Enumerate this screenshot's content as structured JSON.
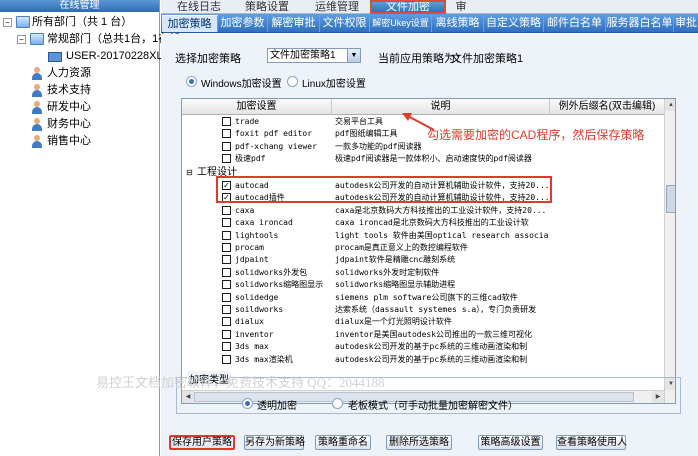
{
  "left_panel": {
    "header": "在线管理",
    "tree": [
      {
        "label": "所有部门（共 1 台）"
      },
      {
        "label": "常规部门（总共1台，1在线)"
      },
      {
        "label": "USER-20170228XL"
      },
      {
        "label": "人力资源"
      },
      {
        "label": "技术支持"
      },
      {
        "label": "研发中心"
      },
      {
        "label": "财务中心"
      },
      {
        "label": "销售中心"
      }
    ]
  },
  "top_tabs": [
    "在线日志",
    "策略设置",
    "运维管理",
    "文件加密",
    "审"
  ],
  "sub_tabs": [
    "加密策略",
    "加密参数",
    "解密审批",
    "文件权限",
    "解密Ukey设置",
    "离线策略",
    "自定义策略",
    "邮件白名单",
    "服务器白名单",
    "审批"
  ],
  "policy": {
    "select_label": "选择加密策略",
    "selected": "文件加密策略1",
    "current_label": "当前应用策略为：",
    "current_value": "文件加密策略1"
  },
  "platform": {
    "windows": "Windows加密设置",
    "linux": "Linux加密设置"
  },
  "grid": {
    "headers": [
      "加密设置",
      "说明",
      "例外后缀名(双击编辑)"
    ],
    "rows_top": [
      {
        "name": "trade",
        "desc": "交易平台工具",
        "checked": false
      },
      {
        "name": "foxit pdf editor",
        "desc": "pdf图纸编辑工具",
        "checked": false
      },
      {
        "name": "pdf-xchang viewer",
        "desc": "一款多功能的pdf阅读器",
        "checked": false
      },
      {
        "name": "极速pdf",
        "desc": "极速pdf阅读器是一款体积小、启动速度快的pdf阅读器",
        "checked": false
      }
    ],
    "group_label": "工程设计",
    "rows_group": [
      {
        "name": "autocad",
        "desc": "autodesk公司开发的自动计算机辅助设计软件，支持20...",
        "checked": true
      },
      {
        "name": "autocad插件",
        "desc": "autodesk公司开发的自动计算机辅助设计软件，支持20...",
        "checked": true
      },
      {
        "name": "caxa",
        "desc": "caxa是北京数码大方科技推出的工业设计软件，支持20...",
        "checked": false
      },
      {
        "name": "caxa ironcad",
        "desc": "caxa ironcad是北京数码大方科技推出的工业设计软",
        "checked": false
      },
      {
        "name": "lightools",
        "desc": "light tools 软件由美国optical research associat...",
        "checked": false
      },
      {
        "name": "procam",
        "desc": "procam是真正意义上的数控编程软件",
        "checked": false
      },
      {
        "name": "jdpaint",
        "desc": "jdpaint软件是精雕cnc雕刻系统",
        "checked": false
      },
      {
        "name": "solidworks外发包",
        "desc": "solidworks外发时定制软件",
        "checked": false
      },
      {
        "name": "solidworks缩略图显示",
        "desc": "solidworks缩略图显示辅助进程",
        "checked": false
      },
      {
        "name": "solidedge",
        "desc": "siemens plm software公司旗下的三维cad软件",
        "checked": false
      },
      {
        "name": "soildworks",
        "desc": "达索系统（dassault systemes s.a），专门负责研发",
        "checked": false
      },
      {
        "name": "dialux",
        "desc": "dialux是一个灯光照明设计软件",
        "checked": false
      },
      {
        "name": "inventor",
        "desc": "inventor是美国autodesk公司推出的一款三维可视化",
        "checked": false
      },
      {
        "name": "3ds max",
        "desc": "autodesk公司开发的基于pc系统的三维动画渲染和制",
        "checked": false
      },
      {
        "name": "3ds max渲染机",
        "desc": "autodesk公司开发的基于pc系统的三维动画渲染和制",
        "checked": false
      }
    ]
  },
  "annotation": "勾选需要加密的CAD程序，然后保存策略",
  "encrypt_type": {
    "title": "加密类型",
    "transparent": "透明加密",
    "whitelist": "老板模式（可手动批量加密解密文件）"
  },
  "watermark": "易控王文档加密软件，免费技术支持 QQ：2044188",
  "buttons": [
    "保存用户策略",
    "另存为新策略",
    "策略重命名",
    "删除所选策略",
    "策略高级设置",
    "查看策略使用人"
  ],
  "colors": {
    "tab_blue": "#2f6fbe",
    "highlight_red": "#e03a2c"
  }
}
